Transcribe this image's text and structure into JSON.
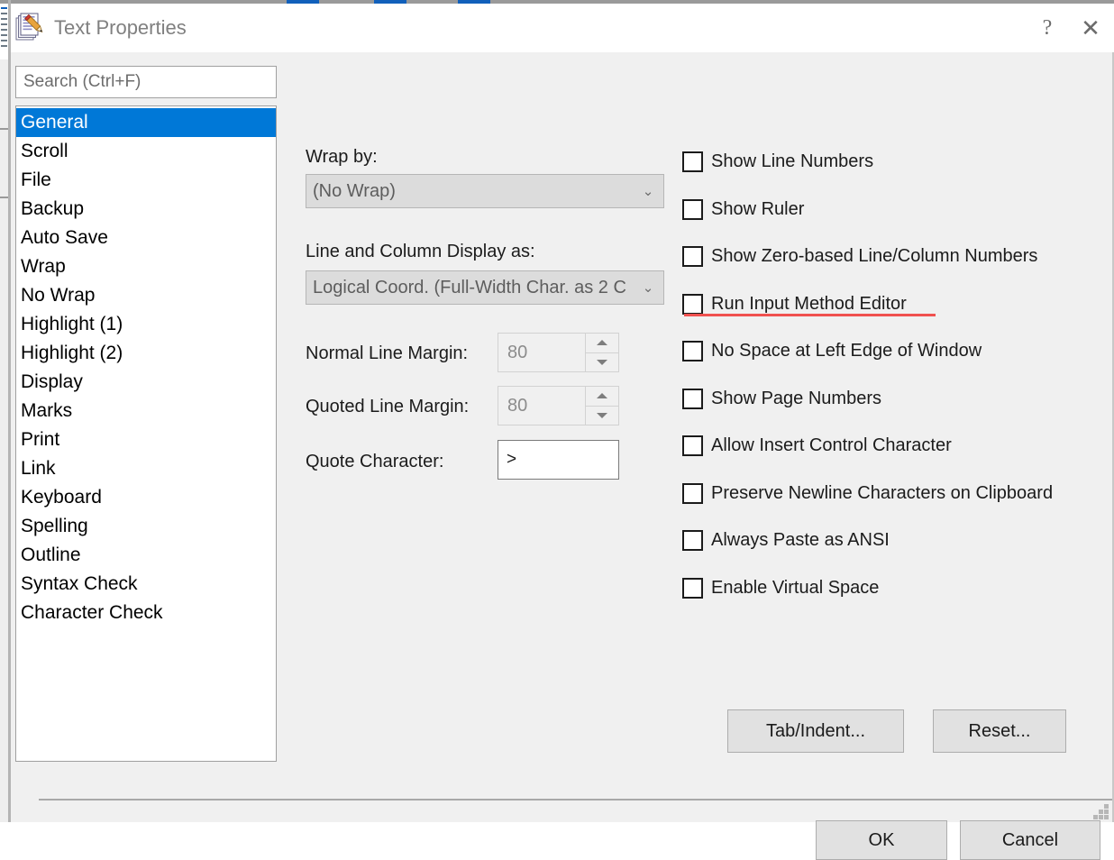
{
  "window": {
    "title": "Text Properties",
    "icon": "notepad-pencil-icon",
    "help_label": "?",
    "close_label": "✕"
  },
  "search": {
    "placeholder": "Search (Ctrl+F)",
    "value": ""
  },
  "categories": {
    "selected": "General",
    "items": [
      "General",
      "Scroll",
      "File",
      "Backup",
      "Auto Save",
      "Wrap",
      "No Wrap",
      "Highlight (1)",
      "Highlight (2)",
      "Display",
      "Marks",
      "Print",
      "Link",
      "Keyboard",
      "Spelling",
      "Outline",
      "Syntax Check",
      "Character Check"
    ]
  },
  "settings": {
    "wrap_by": {
      "label": "Wrap by:",
      "value": "(No Wrap)",
      "arrow": "chevron-down"
    },
    "line_column_display": {
      "label": "Line and Column Display as:",
      "value": "Logical Coord. (Full-Width Char. as 2 C",
      "arrow": "chevron-down"
    },
    "normal_line_margin": {
      "label": "Normal Line Margin:",
      "value": "80"
    },
    "quoted_line_margin": {
      "label": "Quoted Line Margin:",
      "value": "80"
    },
    "quote_character": {
      "label": "Quote Character:",
      "value": ">"
    }
  },
  "checkboxes": [
    {
      "label": "Show Line Numbers",
      "checked": false
    },
    {
      "label": "Show Ruler",
      "checked": false
    },
    {
      "label": "Show Zero-based Line/Column Numbers",
      "checked": false
    },
    {
      "label": "Run Input Method Editor",
      "checked": false,
      "annotated": true
    },
    {
      "label": "No Space at Left Edge of Window",
      "checked": false
    },
    {
      "label": "Show Page Numbers",
      "checked": false
    },
    {
      "label": "Allow Insert Control Character",
      "checked": false
    },
    {
      "label": "Preserve Newline Characters on Clipboard",
      "checked": false
    },
    {
      "label": "Always Paste as ANSI",
      "checked": false
    },
    {
      "label": "Enable Virtual Space",
      "checked": false
    }
  ],
  "buttons": {
    "tab_indent": "Tab/Indent...",
    "reset": "Reset...",
    "ok": "OK",
    "cancel": "Cancel"
  },
  "colors": {
    "selection_blue": "#0078d7",
    "annotation_red": "#f0514f",
    "dialog_background": "#f0f0f0",
    "titlebar_background": "#ffffff",
    "title_text": "#808080"
  }
}
